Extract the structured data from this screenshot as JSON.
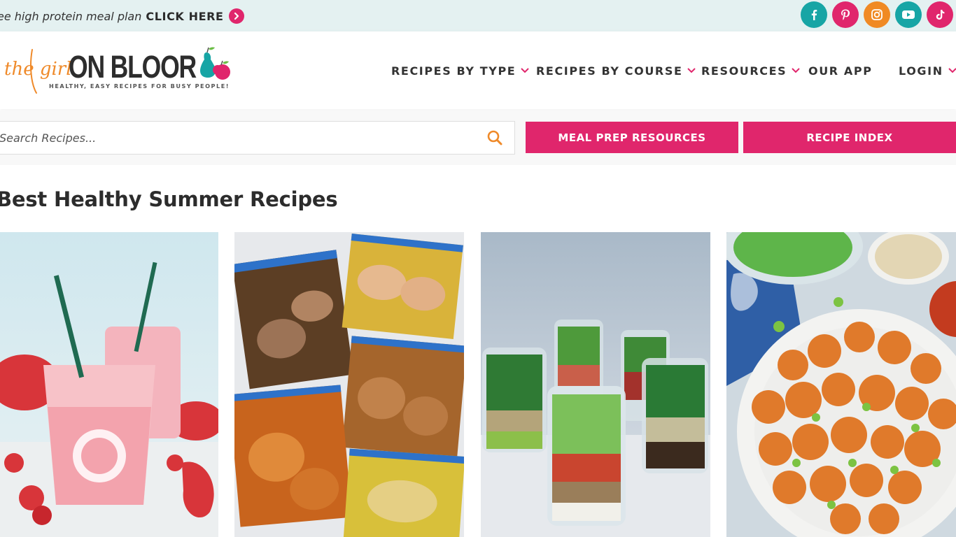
{
  "promo": {
    "text": "ee high protein meal plan",
    "cta": "CLICK HERE",
    "arrow_icon": "chevron-right-icon"
  },
  "social": [
    {
      "name": "facebook-icon",
      "glyph": "f",
      "color": "#17a5a5"
    },
    {
      "name": "pinterest-icon",
      "glyph": "P",
      "color": "#e0266c"
    },
    {
      "name": "instagram-icon",
      "glyph": "ig",
      "color": "#f08a24"
    },
    {
      "name": "youtube-icon",
      "glyph": "yt",
      "color": "#17a5a5"
    },
    {
      "name": "tiktok-icon",
      "glyph": "tt",
      "color": "#e0266c"
    }
  ],
  "logo": {
    "script": "the girl",
    "bold": "ON BLOOR",
    "tagline": "HEALTHY, EASY RECIPES FOR BUSY PEOPLE!"
  },
  "nav": [
    {
      "label": "RECIPES BY TYPE",
      "dropdown": true
    },
    {
      "label": "RECIPES BY COURSE",
      "dropdown": true
    },
    {
      "label": "RESOURCES",
      "dropdown": true
    },
    {
      "label": "OUR APP",
      "dropdown": false
    },
    {
      "label": "LOGIN",
      "dropdown": true
    }
  ],
  "search": {
    "placeholder": "Search Recipes...",
    "icon": "search-icon"
  },
  "buttons": {
    "meal_prep": "MEAL PREP RESOURCES",
    "recipe_index": "RECIPE INDEX"
  },
  "heading": "Best Healthy Summer Recipes",
  "cards": [
    {
      "name": "recipe-card-strawberry-drink",
      "subject": "pink strawberry iced drink"
    },
    {
      "name": "recipe-card-marinated-chicken-bags",
      "subject": "marinated chicken freezer bags"
    },
    {
      "name": "recipe-card-mason-jar-salads",
      "subject": "mason jar salads"
    },
    {
      "name": "recipe-card-sesame-cauliflower",
      "subject": "sesame cauliflower bowl"
    }
  ],
  "colors": {
    "accent": "#e0266c",
    "teal": "#17a5a5",
    "orange": "#f08a24",
    "topbar_bg": "#e4f1f1",
    "text": "#333333"
  }
}
